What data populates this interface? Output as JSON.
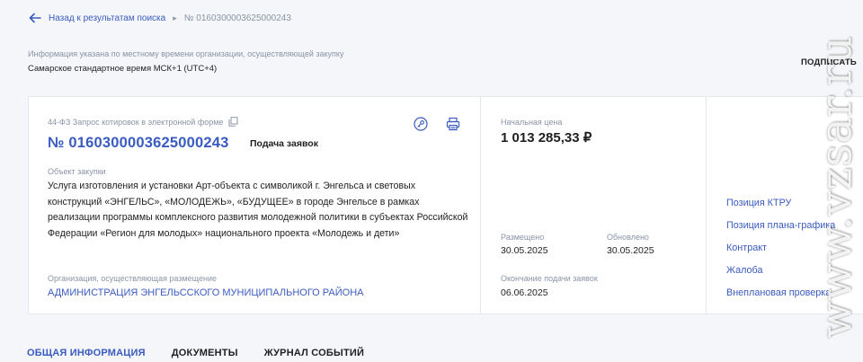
{
  "breadcrumb": {
    "back_label": "Назад к результатам поиска",
    "separator": "▸",
    "current": "№ 0160300003625000243"
  },
  "timezone": {
    "note": "Информация указана по местному времени организации, осуществляющей закупку",
    "value": "Самарское стандартное время МСК+1 (UTC+4)"
  },
  "subscribe_label": "ПОДПИСАТЬ",
  "procurement": {
    "law_type": "44-ФЗ Запрос котировок в электронной форме",
    "number": "№ 0160300003625000243",
    "stage": "Подача заявок",
    "object_label": "Объект закупки",
    "object_text": "Услуга изготовления и установки Арт-объекта с символикой г. Энгельса и световых конструкций «ЭНГЕЛЬС», «МОЛОДЕЖЬ», «БУДУЩЕЕ» в городе Энгельсе в рамках реализации программы комплексного развития молодежной политики в субъектах Российской Федерации «Регион для молодых» национального проекта «Молодежь и дети»",
    "org_label": "Организация, осуществляющая размещение",
    "org_name": "АДМИНИСТРАЦИЯ ЭНГЕЛЬССКОГО МУНИЦИПАЛЬНОГО РАЙОНА"
  },
  "pricing": {
    "price_label": "Начальная цена",
    "price": "1 013 285,33 ₽",
    "placed_label": "Размещено",
    "placed_date": "30.05.2025",
    "updated_label": "Обновлено",
    "updated_date": "30.05.2025",
    "end_label": "Окончание подачи заявок",
    "end_date": "06.06.2025"
  },
  "links": [
    {
      "label": "Позиция КТРУ"
    },
    {
      "label": "Позиция плана-графика"
    },
    {
      "label": "Контракт"
    },
    {
      "label": "Жалоба"
    },
    {
      "label": "Внеплановая проверка"
    }
  ],
  "tabs": [
    {
      "label": "ОБЩАЯ ИНФОРМАЦИЯ",
      "active": true
    },
    {
      "label": "ДОКУМЕНТЫ",
      "active": false
    },
    {
      "label": "ЖУРНАЛ СОБЫТИЙ",
      "active": false
    }
  ],
  "watermark": "www.vzsar.ru",
  "colors": {
    "accent": "#3a5bbf",
    "muted": "#8a94a6",
    "background": "#f4f6f9",
    "card": "#ffffff"
  }
}
